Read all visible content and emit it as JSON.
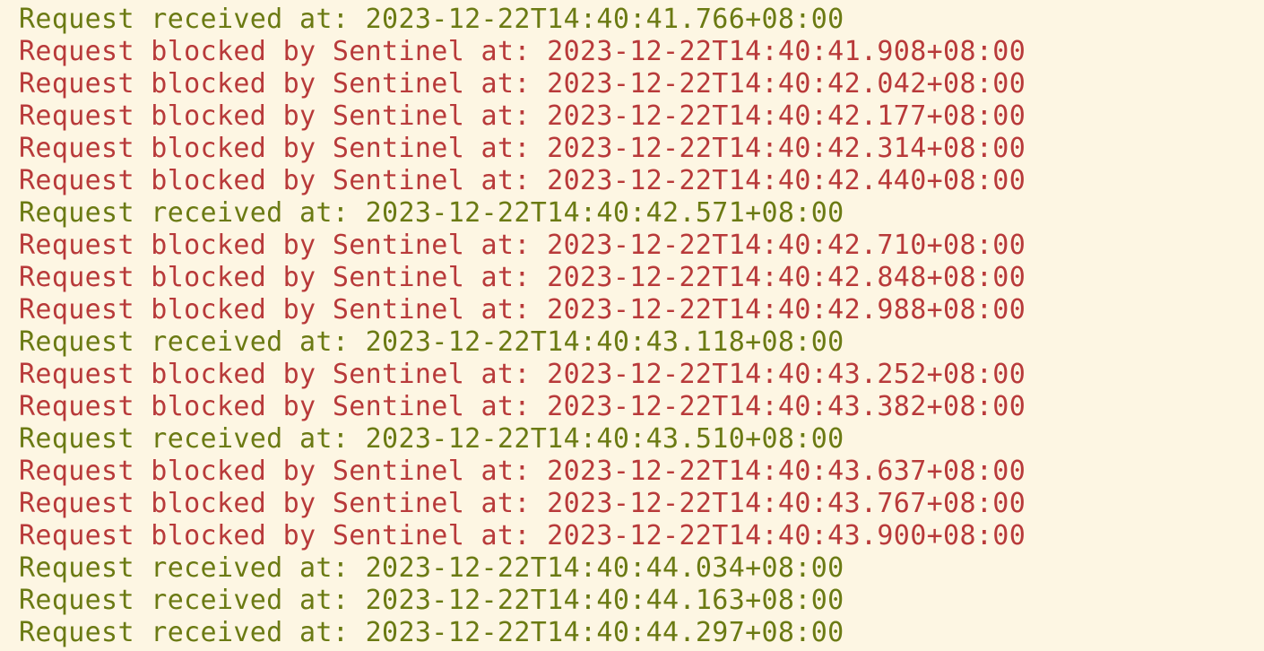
{
  "colors": {
    "background": "#fdf6e3",
    "received": "#6b7a13",
    "blocked": "#b83a3a"
  },
  "log": [
    {
      "type": "received",
      "text": "Request received at: 2023-12-22T14:40:41.766+08:00"
    },
    {
      "type": "blocked",
      "text": "Request blocked by Sentinel at: 2023-12-22T14:40:41.908+08:00"
    },
    {
      "type": "blocked",
      "text": "Request blocked by Sentinel at: 2023-12-22T14:40:42.042+08:00"
    },
    {
      "type": "blocked",
      "text": "Request blocked by Sentinel at: 2023-12-22T14:40:42.177+08:00"
    },
    {
      "type": "blocked",
      "text": "Request blocked by Sentinel at: 2023-12-22T14:40:42.314+08:00"
    },
    {
      "type": "blocked",
      "text": "Request blocked by Sentinel at: 2023-12-22T14:40:42.440+08:00"
    },
    {
      "type": "received",
      "text": "Request received at: 2023-12-22T14:40:42.571+08:00"
    },
    {
      "type": "blocked",
      "text": "Request blocked by Sentinel at: 2023-12-22T14:40:42.710+08:00"
    },
    {
      "type": "blocked",
      "text": "Request blocked by Sentinel at: 2023-12-22T14:40:42.848+08:00"
    },
    {
      "type": "blocked",
      "text": "Request blocked by Sentinel at: 2023-12-22T14:40:42.988+08:00"
    },
    {
      "type": "received",
      "text": "Request received at: 2023-12-22T14:40:43.118+08:00"
    },
    {
      "type": "blocked",
      "text": "Request blocked by Sentinel at: 2023-12-22T14:40:43.252+08:00"
    },
    {
      "type": "blocked",
      "text": "Request blocked by Sentinel at: 2023-12-22T14:40:43.382+08:00"
    },
    {
      "type": "received",
      "text": "Request received at: 2023-12-22T14:40:43.510+08:00"
    },
    {
      "type": "blocked",
      "text": "Request blocked by Sentinel at: 2023-12-22T14:40:43.637+08:00"
    },
    {
      "type": "blocked",
      "text": "Request blocked by Sentinel at: 2023-12-22T14:40:43.767+08:00"
    },
    {
      "type": "blocked",
      "text": "Request blocked by Sentinel at: 2023-12-22T14:40:43.900+08:00"
    },
    {
      "type": "received",
      "text": "Request received at: 2023-12-22T14:40:44.034+08:00"
    },
    {
      "type": "received",
      "text": "Request received at: 2023-12-22T14:40:44.163+08:00"
    },
    {
      "type": "received",
      "text": "Request received at: 2023-12-22T14:40:44.297+08:00"
    }
  ]
}
